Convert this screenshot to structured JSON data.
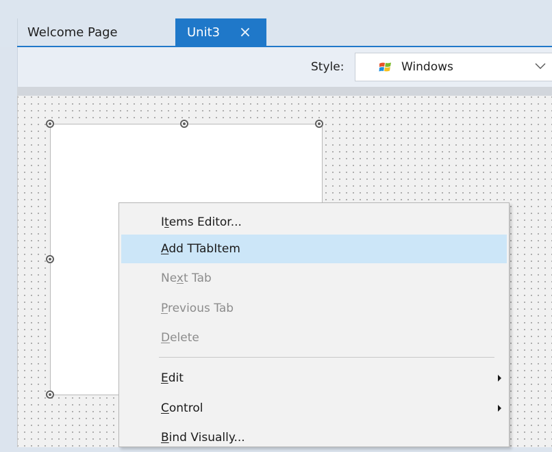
{
  "tabs": [
    {
      "label": "Welcome Page",
      "active": false
    },
    {
      "label": "Unit3",
      "active": true,
      "close_icon": "close-icon"
    }
  ],
  "toolbar": {
    "style_label": "Style:",
    "style_value": "Windows",
    "style_icon": "windows-logo-icon",
    "dropdown_icon": "chevron-down-icon"
  },
  "context_menu": {
    "items": [
      {
        "prefix": "I",
        "mnemonic": "t",
        "rest": "ems Editor...",
        "enabled": true,
        "highlighted": false
      },
      {
        "prefix": "",
        "mnemonic": "A",
        "rest": "dd TTabItem",
        "enabled": true,
        "highlighted": true
      },
      {
        "prefix": "Ne",
        "mnemonic": "x",
        "rest": "t Tab",
        "enabled": false,
        "highlighted": false
      },
      {
        "prefix": "",
        "mnemonic": "P",
        "rest": "revious Tab",
        "enabled": false,
        "highlighted": false
      },
      {
        "prefix": "",
        "mnemonic": "D",
        "rest": "elete",
        "enabled": false,
        "highlighted": false
      },
      {
        "prefix": "",
        "mnemonic": "E",
        "rest": "dit",
        "enabled": true,
        "highlighted": false,
        "submenu": true
      },
      {
        "prefix": "",
        "mnemonic": "C",
        "rest": "ontrol",
        "enabled": true,
        "highlighted": false,
        "submenu": true
      },
      {
        "prefix": "",
        "mnemonic": "B",
        "rest": "ind Visually...",
        "enabled": true,
        "highlighted": false
      }
    ]
  },
  "colors": {
    "active_tab": "#1f78c9",
    "menu_highlight": "#cce6f8",
    "disabled_text": "#8c8c8c"
  }
}
